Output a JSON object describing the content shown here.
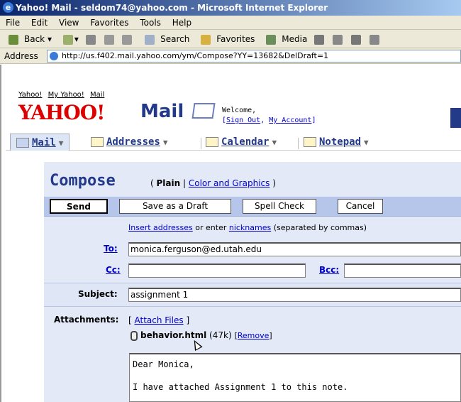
{
  "window": {
    "title": "Yahoo! Mail - seldom74@yahoo.com - Microsoft Internet Explorer"
  },
  "menu": [
    "File",
    "Edit",
    "View",
    "Favorites",
    "Tools",
    "Help"
  ],
  "toolbar": {
    "back": "Back",
    "search": "Search",
    "favorites": "Favorites",
    "media": "Media"
  },
  "address": {
    "label": "Address",
    "url": "http://us.f402.mail.yahoo.com/ym/Compose?YY=13682&DelDraft=1"
  },
  "header": {
    "toplinks": [
      "Yahoo!",
      "My Yahoo!",
      "Mail"
    ],
    "logo": "YAHOO!",
    "logo_mail": "Mail",
    "welcome": "Welcome,",
    "sign_out": "Sign Out",
    "my_account": "My Account"
  },
  "tabs": [
    {
      "label": "Mail"
    },
    {
      "label": "Addresses"
    },
    {
      "label": "Calendar"
    },
    {
      "label": "Notepad"
    }
  ],
  "compose": {
    "title": "Compose",
    "mode_plain": "Plain",
    "mode_color": "Color and Graphics",
    "buttons": {
      "send": "Send",
      "draft": "Save as a Draft",
      "spell": "Spell Check",
      "cancel": "Cancel"
    },
    "insert_addresses": "Insert addresses",
    "or_enter": "or enter",
    "nicknames": "nicknames",
    "separated": "(separated by commas)",
    "to_label": "To:",
    "to_value": "monica.ferguson@ed.utah.edu",
    "cc_label": "Cc:",
    "cc_value": "",
    "bcc_label": "Bcc:",
    "bcc_value": "",
    "subject_label": "Subject:",
    "subject_value": "assignment 1",
    "attachments_label": "Attachments:",
    "attach_files": "Attach Files",
    "file_name": "behavior.html",
    "file_size": "(47k)",
    "remove": "Remove",
    "body": "Dear Monica,\n\nI have attached Assignment 1 to this note."
  },
  "colors": {
    "yahoo_red": "#dd0000",
    "yahoo_blue": "#233a8a",
    "panel": "#e3e9f7",
    "button_bar": "#b6c6ea"
  }
}
